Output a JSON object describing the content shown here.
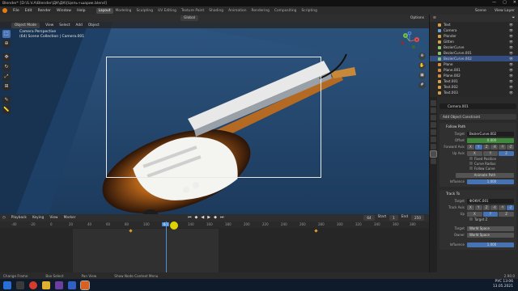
{
  "titlebar": {
    "title": "Blender* [D:\\S.V.A\\Blender\\ДК\\ДК\\[Цепь+шарик.blend]",
    "min": "—",
    "max": "▢",
    "close": "✕"
  },
  "menubar": {
    "items": [
      "File",
      "Edit",
      "Render",
      "Window",
      "Help"
    ],
    "workspaces": [
      "Layout",
      "Modeling",
      "Sculpting",
      "UV Editing",
      "Texture Paint",
      "Shading",
      "Animation",
      "Rendering",
      "Compositing",
      "Scripting"
    ],
    "scene": "Scene",
    "view_layer": "View Layer"
  },
  "toolheader": {
    "mode": "Object Mode",
    "menus": [
      "View",
      "Select",
      "Add",
      "Object"
    ],
    "orientation": "Global",
    "options": "Options"
  },
  "viewport": {
    "camera_line1": "Camera Perspective",
    "camera_line2": "(64) Scene Collection | Camera.001",
    "gizmo_x": "X",
    "gizmo_y": "Y",
    "gizmo_z": "Z"
  },
  "timeline": {
    "menus": [
      "Playback",
      "Keying",
      "View",
      "Marker"
    ],
    "current_frame": "64",
    "start_label": "Start",
    "start": "1",
    "end_label": "End",
    "end": "250",
    "ticks": [
      "-40",
      "-20",
      "0",
      "20",
      "40",
      "60",
      "80",
      "100",
      "120",
      "140",
      "160",
      "180",
      "200",
      "220",
      "240",
      "260",
      "280",
      "300",
      "320",
      "340",
      "360",
      "380",
      "400"
    ],
    "playhead_label": "64"
  },
  "statusbar": {
    "items": [
      "Change Frame",
      "Box Select",
      "Pan View",
      "Show Node Context Menu"
    ],
    "version": "2.90.0"
  },
  "taskbar": {
    "time": "13:06",
    "date": "13.05.2021",
    "lang": "РУС"
  },
  "outliner": {
    "rows": [
      {
        "name": "Text",
        "color": "#d8a040",
        "selected": false
      },
      {
        "name": "Camera",
        "color": "#6aa0d8",
        "selected": false
      },
      {
        "name": "Plonder",
        "color": "#d8a040",
        "selected": false
      },
      {
        "name": "Gitten",
        "color": "#d8a040",
        "selected": false
      },
      {
        "name": "BezierCurve",
        "color": "#8ac76a",
        "selected": false
      },
      {
        "name": "BezierCurve.001",
        "color": "#8ac76a",
        "selected": false
      },
      {
        "name": "BezierCurve.002",
        "color": "#8ac76a",
        "selected": true
      },
      {
        "name": "Plane",
        "color": "#d88a40",
        "selected": false
      },
      {
        "name": "Plane.001",
        "color": "#d88a40",
        "selected": false
      },
      {
        "name": "Plane.002",
        "color": "#d88a40",
        "selected": false
      },
      {
        "name": "Text.001",
        "color": "#d8a040",
        "selected": false
      },
      {
        "name": "Text.002",
        "color": "#d8a040",
        "selected": false
      },
      {
        "name": "Text.003",
        "color": "#d8a040",
        "selected": false
      }
    ]
  },
  "properties": {
    "object_name": "Camera.001",
    "add_constraint": "Add Object Constraint",
    "follow_path": {
      "title": "Follow Path",
      "target_label": "Target",
      "target": "BezierCurve.002",
      "offset_label": "Offset",
      "offset": "0.000",
      "forward_label": "Forward Axis",
      "forward_axes": [
        "X",
        "Y",
        "Z",
        "-X",
        "-Y",
        "-Z"
      ],
      "up_label": "Up Axis",
      "up_axes": [
        "X",
        "Y",
        "Z"
      ],
      "fixed_position": "Fixed Position",
      "curve_radius": "Curve Radius",
      "follow_curve": "Follow Curve",
      "animate_path": "Animate Path",
      "influence_label": "Influence",
      "influence": "1.000"
    },
    "track_to": {
      "title": "Track To",
      "target_label": "Target",
      "target": "ФОКУС.001",
      "track_axis_label": "Track Axis",
      "track_axes": [
        "X",
        "Y",
        "Z",
        "-X",
        "-Y",
        "-Z"
      ],
      "up_label": "Up",
      "up_axes": [
        "X",
        "Y",
        "Z"
      ],
      "target_z": "Target Z",
      "target_space_label": "Target",
      "target_space": "World Space",
      "owner_space_label": "Owner",
      "owner_space": "World Space",
      "influence_label": "Influence",
      "influence": "1.000"
    }
  }
}
